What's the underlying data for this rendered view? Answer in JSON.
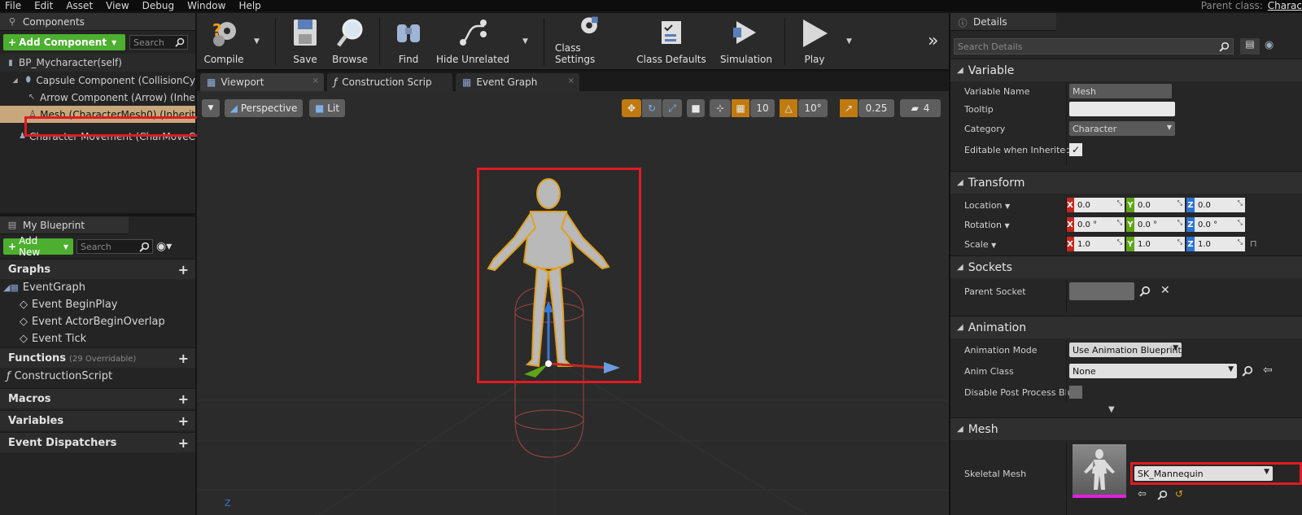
{
  "menu": {
    "items": [
      "File",
      "Edit",
      "Asset",
      "View",
      "Debug",
      "Window",
      "Help"
    ],
    "parent_class_label": "Parent class:",
    "parent_class_value": "Charac"
  },
  "components": {
    "title": "Components",
    "add_button": "Add Component",
    "search_placeholder": "Search",
    "root": "BP_Mycharacter(self)",
    "tree": [
      {
        "label": "Capsule Component (CollisionCy",
        "icon": "capsule-icon"
      },
      {
        "label": "Arrow Component (Arrow) (Inhe",
        "icon": "arrow-icon"
      },
      {
        "label": "Mesh (CharacterMesh0) (Inherit",
        "icon": "mesh-icon"
      },
      {
        "label": "Character Movement (CharMoveC",
        "icon": "character-movement-icon"
      }
    ]
  },
  "my_blueprint": {
    "title": "My Blueprint",
    "add_new": "Add New",
    "search_placeholder": "Search",
    "graphs": "Graphs",
    "event_graph": "EventGraph",
    "events": [
      "Event BeginPlay",
      "Event ActorBeginOverlap",
      "Event Tick"
    ],
    "functions": "Functions",
    "functions_sub": "(29 Overridable)",
    "construction_script": "ConstructionScript",
    "macros": "Macros",
    "variables": "Variables",
    "event_dispatchers": "Event Dispatchers"
  },
  "toolbar": {
    "compile": "Compile",
    "save": "Save",
    "browse": "Browse",
    "find": "Find",
    "hide_unrelated": "Hide Unrelated",
    "class_settings": "Class Settings",
    "class_defaults": "Class Defaults",
    "simulation": "Simulation",
    "play": "Play",
    "more": "»"
  },
  "editor_tabs": [
    "Viewport",
    "Construction Scrip",
    "Event Graph"
  ],
  "viewport": {
    "perspective": "Perspective",
    "lit": "Lit",
    "grid_snap": "10",
    "rotation_snap": "10°",
    "scale_snap": "0.25",
    "camera_speed": "4",
    "axis_label": "Z"
  },
  "details": {
    "title": "Details",
    "search_placeholder": "Search Details",
    "variable_section": "Variable",
    "variable_name_label": "Variable Name",
    "variable_name_value": "Mesh",
    "tooltip_label": "Tooltip",
    "tooltip_value": "",
    "category_label": "Category",
    "category_value": "Character",
    "editable_label": "Editable when Inherited",
    "editable_checked": true,
    "transform_section": "Transform",
    "location_label": "Location",
    "rotation_label": "Rotation",
    "scale_label": "Scale",
    "location": [
      "0.0",
      "0.0",
      "0.0"
    ],
    "rotation": [
      "0.0 °",
      "0.0 °",
      "0.0 °"
    ],
    "scale": [
      "1.0",
      "1.0",
      "1.0"
    ],
    "sockets_section": "Sockets",
    "parent_socket_label": "Parent Socket",
    "animation_section": "Animation",
    "animation_mode_label": "Animation Mode",
    "animation_mode_value": "Use Animation Blueprint",
    "anim_class_label": "Anim Class",
    "anim_class_value": "None",
    "disable_pp_label": "Disable Post Process Blue",
    "mesh_section": "Mesh",
    "skeletal_mesh_label": "Skeletal Mesh",
    "skeletal_mesh_value": "SK_Mannequin"
  },
  "colors": {
    "accent_orange": "#c07a10",
    "highlight_red": "#e11b22",
    "button_green": "#4caf2f",
    "axis_x": "#c4281c",
    "axis_y": "#5ea616",
    "axis_z": "#2c73d6"
  }
}
